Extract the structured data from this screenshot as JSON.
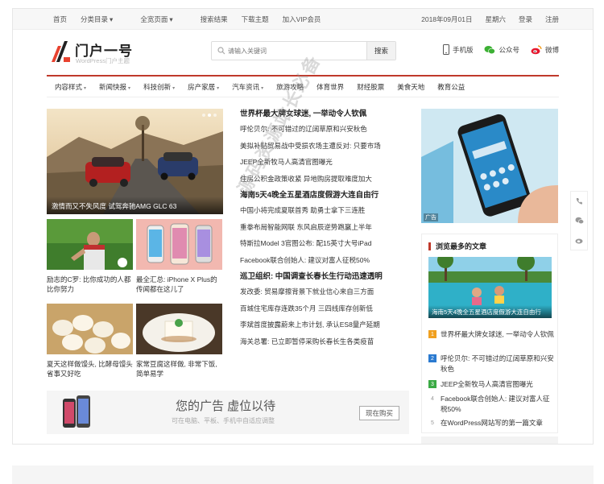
{
  "topbar": {
    "left": [
      "首页",
      "分类目录",
      "全宽页面",
      "搜索结果",
      "下载主题",
      "加入VIP会员"
    ],
    "right": [
      "2018年09月01日",
      "星期六",
      "登录",
      "注册"
    ]
  },
  "logo": {
    "title": "门户一号",
    "subtitle": "WordPress门户主题"
  },
  "search": {
    "placeholder": "请输入关键词",
    "button": "搜索"
  },
  "header_links": [
    {
      "label": "手机版",
      "icon": "mobile-icon"
    },
    {
      "label": "公众号",
      "icon": "wechat-icon"
    },
    {
      "label": "微博",
      "icon": "weibo-icon"
    }
  ],
  "nav": [
    {
      "label": "内容样式",
      "dropdown": true
    },
    {
      "label": "新闻快报",
      "dropdown": true
    },
    {
      "label": "科技创新",
      "dropdown": true
    },
    {
      "label": "房产家居",
      "dropdown": true
    },
    {
      "label": "汽车资讯",
      "dropdown": true
    },
    {
      "label": "旅游攻略",
      "dropdown": false
    },
    {
      "label": "体育世界",
      "dropdown": false
    },
    {
      "label": "财经股票",
      "dropdown": false
    },
    {
      "label": "美食天地",
      "dropdown": false
    },
    {
      "label": "教育公益",
      "dropdown": false
    }
  ],
  "hero": {
    "caption": "激情而又不失风度 试驾奔驰AMG GLC 63"
  },
  "thumbs": [
    {
      "caption": "励志的C罗: 比你成功的人都比你努力"
    },
    {
      "caption": "最全汇总: iPhone X Plus的传闻都在这儿了"
    },
    {
      "caption": "夏天这样做馒头, 比酵母馒头省事又好吃"
    },
    {
      "caption": "家常豆腐这样做, 非常下饭, 简单易学"
    }
  ],
  "news": [
    {
      "title": "世界杯最大牌女球迷, 一举动令人钦佩",
      "items": [
        "呼伦贝尔: 不可错过的辽阔草原和兴安秋色",
        "美拟补贴贸易战中受损农场主遭反对: 只要市场",
        "JEEP全新牧马人高清官图曝光",
        "住房公积金政策收紧 异地购房提取难度加大"
      ]
    },
    {
      "title": "海南5天4晚全五星酒店度假游大连自由行",
      "items": [
        "中国小将完成夏联首秀 助勇士拿下三连胜",
        "重拳布局智能网联 东风启辰逆势跑赢上半年",
        "特斯拉Model 3官图公布: 配15英寸大号iPad",
        "Facebook联合创始人: 建议对富人征税50%"
      ]
    },
    {
      "title": "巡卫组织: 中国调查长春长生行动迅速透明",
      "items": [
        "发改委: 贸易摩擦背景下就业信心来自三方面",
        "百城住宅库存连跌35个月 三四线库存创新低",
        "李斌首度披露蔚来上市计划, 承认ES8量产延期",
        "海关总署: 已立即暂停采购长春长生各类疫苗"
      ]
    }
  ],
  "ad": {
    "title": "您的广告 虚位以待",
    "subtitle": "可在电脑、平板、手机中自适应调整",
    "button": "现在购买"
  },
  "side_ad": {
    "badge": "广告"
  },
  "popular": {
    "heading": "浏览最多的文章",
    "hot_caption": "海南5天4晚全五星酒店度假游大连自由行",
    "items": [
      {
        "num": "1",
        "text": "世界杯最大牌女球迷, 一举动令人钦佩",
        "color": "#f0a020"
      },
      {
        "num": "2",
        "text": "呼伦贝尔: 不可错过的辽阔草原和兴安秋色",
        "color": "#2a7ad0"
      },
      {
        "num": "3",
        "text": "JEEP全新牧马人高清官图曝光",
        "color": "#3aaa44"
      },
      {
        "num": "4",
        "text": "Facebook联合创始人: 建议对富人征税50%",
        "color": "#ffffff"
      },
      {
        "num": "5",
        "text": "在WordPress网站写的第一篇文章",
        "color": "#ffffff"
      }
    ]
  },
  "watermark": "源码资源站长必备"
}
